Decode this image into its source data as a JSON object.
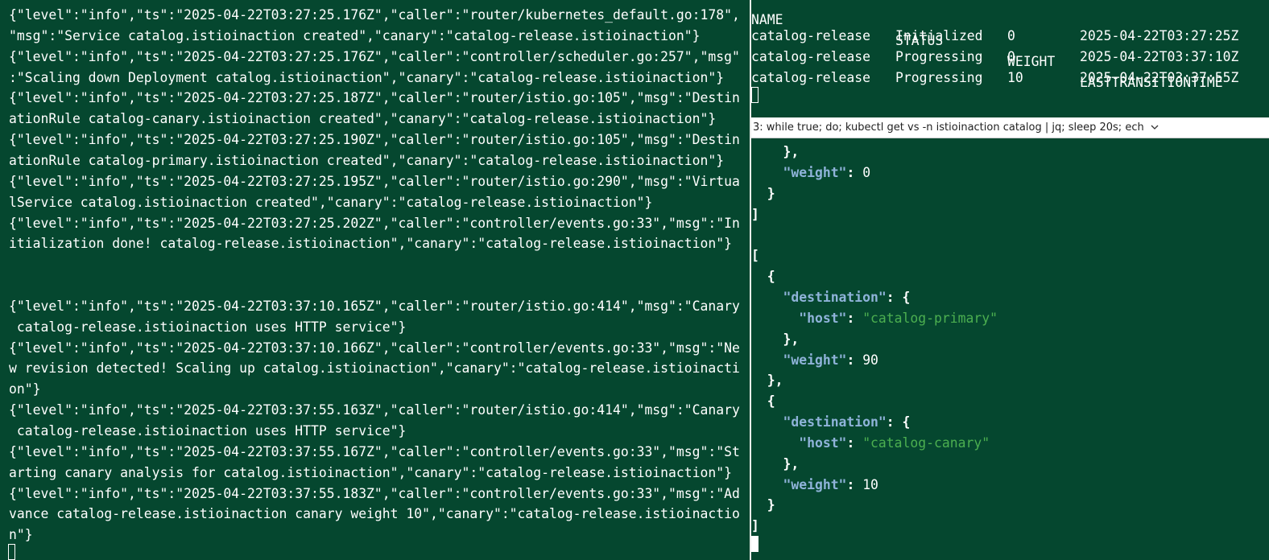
{
  "left_log": [
    "{\"level\":\"info\",\"ts\":\"2025-04-22T03:27:25.176Z\",\"caller\":\"router/kubernetes_default.go:178\",",
    "\"msg\":\"Service catalog.istioinaction created\",\"canary\":\"catalog-release.istioinaction\"}",
    "{\"level\":\"info\",\"ts\":\"2025-04-22T03:27:25.176Z\",\"caller\":\"controller/scheduler.go:257\",\"msg\"",
    ":\"Scaling down Deployment catalog.istioinaction\",\"canary\":\"catalog-release.istioinaction\"}",
    "{\"level\":\"info\",\"ts\":\"2025-04-22T03:27:25.187Z\",\"caller\":\"router/istio.go:105\",\"msg\":\"Destin",
    "ationRule catalog-canary.istioinaction created\",\"canary\":\"catalog-release.istioinaction\"}",
    "{\"level\":\"info\",\"ts\":\"2025-04-22T03:27:25.190Z\",\"caller\":\"router/istio.go:105\",\"msg\":\"Destin",
    "ationRule catalog-primary.istioinaction created\",\"canary\":\"catalog-release.istioinaction\"}",
    "{\"level\":\"info\",\"ts\":\"2025-04-22T03:27:25.195Z\",\"caller\":\"router/istio.go:290\",\"msg\":\"Virtua",
    "lService catalog.istioinaction created\",\"canary\":\"catalog-release.istioinaction\"}",
    "{\"level\":\"info\",\"ts\":\"2025-04-22T03:27:25.202Z\",\"caller\":\"controller/events.go:33\",\"msg\":\"In",
    "itialization done! catalog-release.istioinaction\",\"canary\":\"catalog-release.istioinaction\"}",
    "",
    "",
    "{\"level\":\"info\",\"ts\":\"2025-04-22T03:37:10.165Z\",\"caller\":\"router/istio.go:414\",\"msg\":\"Canary",
    " catalog-release.istioinaction uses HTTP service\"}",
    "{\"level\":\"info\",\"ts\":\"2025-04-22T03:37:10.166Z\",\"caller\":\"controller/events.go:33\",\"msg\":\"Ne",
    "w revision detected! Scaling up catalog.istioinaction\",\"canary\":\"catalog-release.istioinacti",
    "on\"}",
    "{\"level\":\"info\",\"ts\":\"2025-04-22T03:37:55.163Z\",\"caller\":\"router/istio.go:414\",\"msg\":\"Canary",
    " catalog-release.istioinaction uses HTTP service\"}",
    "{\"level\":\"info\",\"ts\":\"2025-04-22T03:37:55.167Z\",\"caller\":\"controller/events.go:33\",\"msg\":\"St",
    "arting canary analysis for catalog.istioinaction\",\"canary\":\"catalog-release.istioinaction\"}",
    "{\"level\":\"info\",\"ts\":\"2025-04-22T03:37:55.183Z\",\"caller\":\"controller/events.go:33\",\"msg\":\"Ad",
    "vance catalog-release.istioinaction canary weight 10\",\"canary\":\"catalog-release.istioinactio",
    "n\"}"
  ],
  "canary_table": {
    "headers": [
      "NAME",
      "STATUS",
      "WEIGHT",
      "LASTTRANSITIONTIME"
    ],
    "rows": [
      [
        "catalog-release",
        "Initialized",
        "0",
        "2025-04-22T03:27:25Z"
      ],
      [
        "catalog-release",
        "Progressing",
        "0",
        "2025-04-22T03:37:10Z"
      ],
      [
        "catalog-release",
        "Progressing",
        "10",
        "2025-04-22T03:37:55Z"
      ]
    ]
  },
  "pane_header": {
    "title": "3: while true; do; kubectl get vs -n istioinaction catalog  | jq; sleep 20s; ech"
  },
  "jq_output": {
    "lines": [
      [
        {
          "t": "p",
          "v": "    },"
        }
      ],
      [
        {
          "t": "p",
          "v": "    "
        },
        {
          "t": "k",
          "v": "\"weight\""
        },
        {
          "t": "p",
          "v": ": "
        },
        {
          "t": "n",
          "v": "0"
        }
      ],
      [
        {
          "t": "p",
          "v": "  }"
        }
      ],
      [
        {
          "t": "p",
          "v": "]"
        }
      ],
      [],
      [
        {
          "t": "p",
          "v": "["
        }
      ],
      [
        {
          "t": "p",
          "v": "  {"
        }
      ],
      [
        {
          "t": "p",
          "v": "    "
        },
        {
          "t": "k",
          "v": "\"destination\""
        },
        {
          "t": "p",
          "v": ": {"
        }
      ],
      [
        {
          "t": "p",
          "v": "      "
        },
        {
          "t": "k",
          "v": "\"host\""
        },
        {
          "t": "p",
          "v": ": "
        },
        {
          "t": "s",
          "v": "\"catalog-primary\""
        }
      ],
      [
        {
          "t": "p",
          "v": "    },"
        }
      ],
      [
        {
          "t": "p",
          "v": "    "
        },
        {
          "t": "k",
          "v": "\"weight\""
        },
        {
          "t": "p",
          "v": ": "
        },
        {
          "t": "n",
          "v": "90"
        }
      ],
      [
        {
          "t": "p",
          "v": "  },"
        }
      ],
      [
        {
          "t": "p",
          "v": "  {"
        }
      ],
      [
        {
          "t": "p",
          "v": "    "
        },
        {
          "t": "k",
          "v": "\"destination\""
        },
        {
          "t": "p",
          "v": ": {"
        }
      ],
      [
        {
          "t": "p",
          "v": "      "
        },
        {
          "t": "k",
          "v": "\"host\""
        },
        {
          "t": "p",
          "v": ": "
        },
        {
          "t": "s",
          "v": "\"catalog-canary\""
        }
      ],
      [
        {
          "t": "p",
          "v": "    },"
        }
      ],
      [
        {
          "t": "p",
          "v": "    "
        },
        {
          "t": "k",
          "v": "\"weight\""
        },
        {
          "t": "p",
          "v": ": "
        },
        {
          "t": "n",
          "v": "10"
        }
      ],
      [
        {
          "t": "p",
          "v": "  }"
        }
      ],
      [
        {
          "t": "p",
          "v": "]"
        }
      ]
    ]
  },
  "colors": {
    "terminal_bg": "#05472f",
    "text": "#ffffff",
    "json_key": "#8fb3d9",
    "json_string": "#4caf50",
    "header_bg": "#ffffff"
  },
  "icons": {
    "header_dropdown": "chevron-down-icon"
  }
}
